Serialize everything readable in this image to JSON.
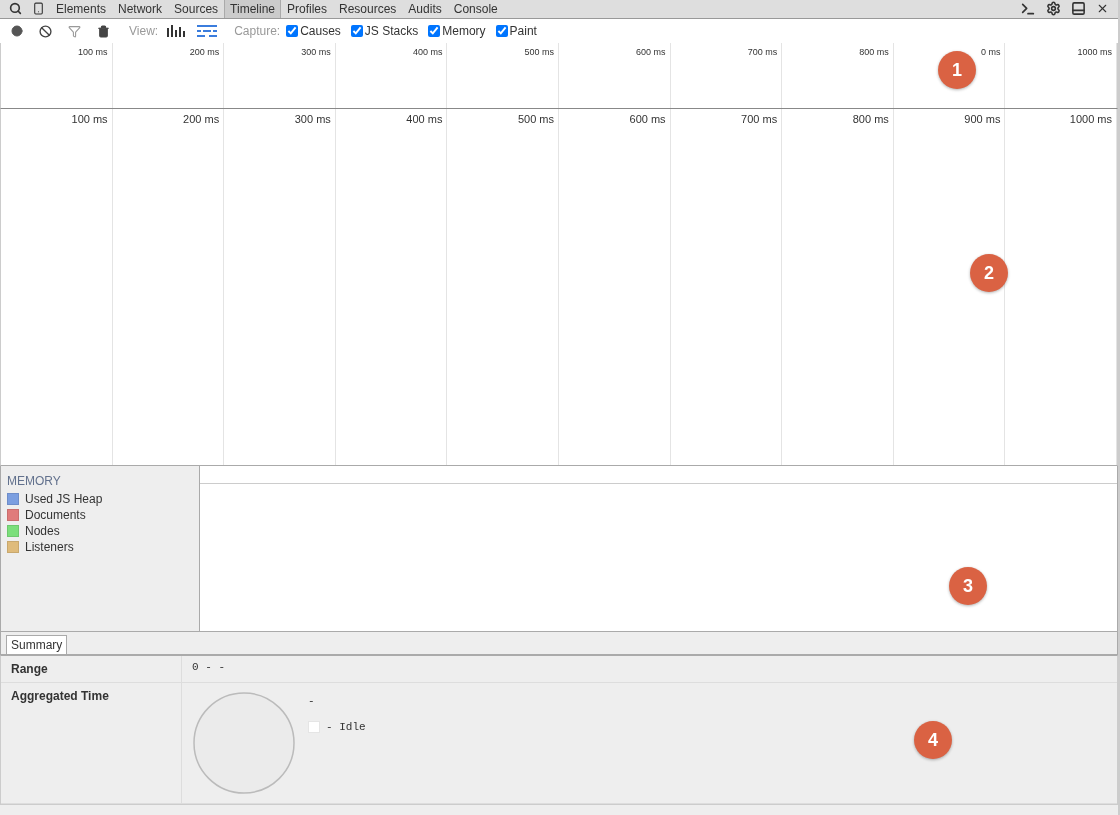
{
  "tabs": [
    {
      "label": "Elements",
      "selected": false
    },
    {
      "label": "Network",
      "selected": false
    },
    {
      "label": "Sources",
      "selected": false
    },
    {
      "label": "Timeline",
      "selected": true
    },
    {
      "label": "Profiles",
      "selected": false
    },
    {
      "label": "Resources",
      "selected": false
    },
    {
      "label": "Audits",
      "selected": false
    },
    {
      "label": "Console",
      "selected": false
    }
  ],
  "toolbar": {
    "view_label": "View:",
    "capture_label": "Capture:",
    "view_modes": [
      {
        "kind": "bars",
        "selected": false
      },
      {
        "kind": "flame",
        "selected": true
      }
    ],
    "captures": [
      {
        "label": "Causes",
        "checked": true
      },
      {
        "label": "JS Stacks",
        "checked": true
      },
      {
        "label": "Memory",
        "checked": true
      },
      {
        "label": "Paint",
        "checked": true
      }
    ]
  },
  "overview": {
    "ticks": [
      "100 ms",
      "200 ms",
      "300 ms",
      "400 ms",
      "500 ms",
      "600 ms",
      "700 ms",
      "800 ms",
      "0 ms",
      "1000 ms"
    ]
  },
  "timeline": {
    "ticks": [
      "100 ms",
      "200 ms",
      "300 ms",
      "400 ms",
      "500 ms",
      "600 ms",
      "700 ms",
      "800 ms",
      "900 ms",
      "1000 ms"
    ]
  },
  "memory": {
    "title": "MEMORY",
    "counters": [
      {
        "label": "Used JS Heap",
        "color": "#7b9ee0"
      },
      {
        "label": "Documents",
        "color": "#e07b7b"
      },
      {
        "label": "Nodes",
        "color": "#7bdf7b"
      },
      {
        "label": "Listeners",
        "color": "#dfbb7b"
      }
    ]
  },
  "details": {
    "tabs": [
      {
        "label": "Summary",
        "selected": true
      }
    ],
    "rows": [
      {
        "kind": "range",
        "label": "Range",
        "value": "0 - -"
      },
      {
        "kind": "aggregated",
        "label": "Aggregated Time",
        "total": "-",
        "legend": [
          {
            "label": "- Idle",
            "color": "#ffffff"
          }
        ]
      }
    ]
  },
  "callouts": [
    "1",
    "2",
    "3",
    "4"
  ]
}
